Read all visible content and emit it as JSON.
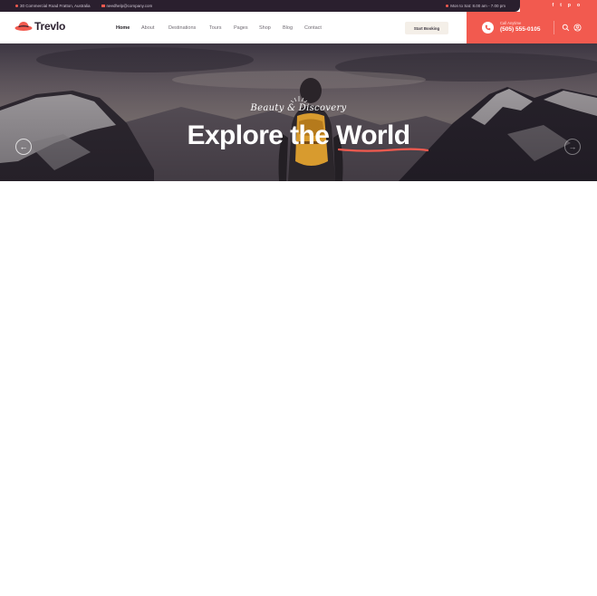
{
  "topbar": {
    "address": "30 Commercial Road Fratton, Australia",
    "email": "needhelp@company.com",
    "hours": "Mon to Sat: 8.00 am - 7.00 pm"
  },
  "social": {
    "facebook": "f",
    "twitter": "t",
    "pinterest": "p",
    "instagram": "o"
  },
  "header": {
    "logo_text": "Trevlo",
    "nav": [
      "Home",
      "About",
      "Destinations",
      "Tours",
      "Pages",
      "Shop",
      "Blog",
      "Contact"
    ],
    "active_nav": "Home",
    "book_label": "Start Booking",
    "call_label": "Call Anytime",
    "call_number": "(505) 555-0105"
  },
  "hero": {
    "tagline": "Beauty & Discovery",
    "title_main": "Explore the ",
    "title_highlight": "World",
    "prev_arrow": "←",
    "next_arrow": "→"
  },
  "colors": {
    "accent": "#f25a4f",
    "dark": "#2a1f2e"
  }
}
